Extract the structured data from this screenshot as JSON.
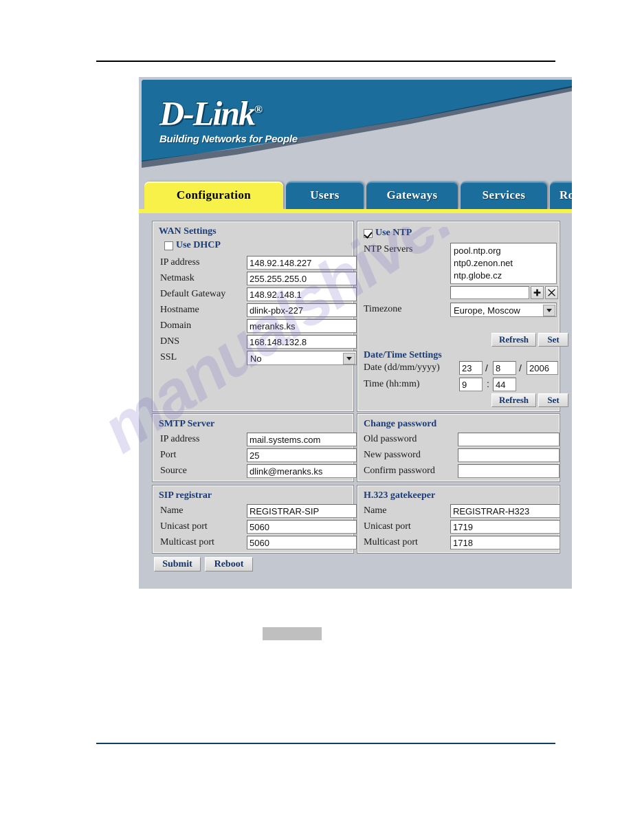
{
  "app": {
    "brand": "D-Link",
    "brand_reg": "®",
    "tagline": "Building Networks for People"
  },
  "tabs": [
    {
      "label": "Configuration",
      "active": true
    },
    {
      "label": "Users",
      "active": false
    },
    {
      "label": "Gateways",
      "active": false
    },
    {
      "label": "Services",
      "active": false
    },
    {
      "label": "Rout",
      "active": false
    }
  ],
  "wan": {
    "legend": "WAN Settings",
    "use_dhcp_label": "Use DHCP",
    "use_dhcp_checked": false,
    "fields": [
      {
        "label": "IP address",
        "value": "148.92.148.227"
      },
      {
        "label": "Netmask",
        "value": "255.255.255.0"
      },
      {
        "label": "Default Gateway",
        "value": "148.92.148.1"
      },
      {
        "label": "Hostname",
        "value": "dlink-pbx-227"
      },
      {
        "label": "Domain",
        "value": "meranks.ks"
      },
      {
        "label": "DNS",
        "value": "168.148.132.8"
      }
    ],
    "ssl_label": "SSL",
    "ssl_value": "No"
  },
  "ntp": {
    "use_ntp_label": "Use NTP",
    "use_ntp_checked": true,
    "servers_label": "NTP Servers",
    "servers": [
      "pool.ntp.org",
      "ntp0.zenon.net",
      "ntp.globe.cz"
    ],
    "new_server_value": "",
    "add_icon": "plus-icon",
    "remove_icon": "close-x-icon",
    "timezone_label": "Timezone",
    "timezone_value": "Europe, Moscow",
    "refresh_label": "Refresh",
    "set_label": "Set"
  },
  "datetime": {
    "legend": "Date/Time Settings",
    "date_label": "Date (dd/mm/yyyy)",
    "date_day": "23",
    "date_month": "8",
    "date_year": "2006",
    "date_sep": "/",
    "time_label": "Time (hh:mm)",
    "time_hour": "9",
    "time_min": "44",
    "time_sep": ":",
    "refresh_label": "Refresh",
    "set_label": "Set"
  },
  "smtp": {
    "legend": "SMTP Server",
    "fields": [
      {
        "label": "IP address",
        "value": "mail.systems.com"
      },
      {
        "label": "Port",
        "value": "25"
      },
      {
        "label": "Source",
        "value": "dlink@meranks.ks"
      }
    ]
  },
  "password": {
    "legend": "Change password",
    "fields": [
      {
        "label": "Old password",
        "value": ""
      },
      {
        "label": "New password",
        "value": ""
      },
      {
        "label": "Confirm password",
        "value": ""
      }
    ]
  },
  "sip": {
    "legend": "SIP registrar",
    "fields": [
      {
        "label": "Name",
        "value": "REGISTRAR-SIP"
      },
      {
        "label": "Unicast port",
        "value": "5060"
      },
      {
        "label": "Multicast port",
        "value": "5060"
      }
    ]
  },
  "h323": {
    "legend": "H.323 gatekeeper",
    "fields": [
      {
        "label": "Name",
        "value": "REGISTRAR-H323"
      },
      {
        "label": "Unicast port",
        "value": "1719"
      },
      {
        "label": "Multicast port",
        "value": "1718"
      }
    ]
  },
  "actions": {
    "submit_label": "Submit",
    "reboot_label": "Reboot"
  },
  "watermark": {
    "text": "manualshive.com"
  },
  "colors": {
    "brand_blue": "#1b6d9c",
    "active_tab_yellow": "#f7f14a",
    "legend_blue": "#1a3c7a",
    "panel_gray": "#d4d4d4",
    "page_gray": "#c3c7cf",
    "footer_rule": "#103f66"
  }
}
